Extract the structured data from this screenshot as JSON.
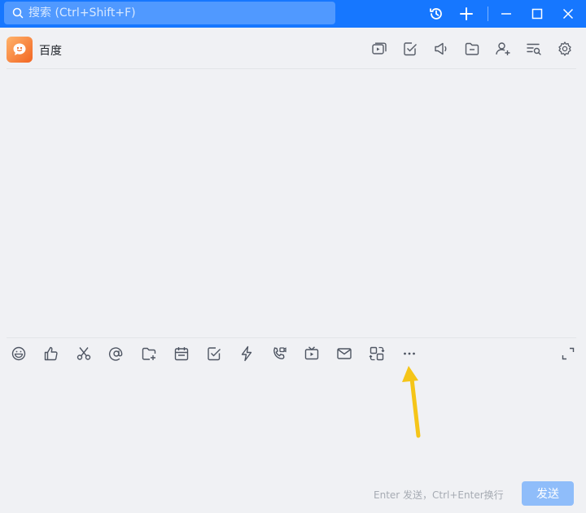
{
  "titlebar": {
    "search_placeholder": "搜索 (Ctrl+Shift+F)",
    "icons": [
      "search-icon",
      "history-icon",
      "plus-icon",
      "minimize-icon",
      "maximize-icon",
      "close-icon"
    ]
  },
  "header": {
    "chat_name": "百度",
    "icons": [
      "video-call-icon",
      "task-check-icon",
      "announcement-icon",
      "folder-icon",
      "add-member-icon",
      "search-history-icon",
      "settings-icon"
    ]
  },
  "toolbar": {
    "icons": [
      "emoji-icon",
      "thumbs-up-icon",
      "scissors-icon",
      "mention-icon",
      "folder-add-icon",
      "calendar-icon",
      "checkbox-icon",
      "lightning-icon",
      "phone-video-icon",
      "live-tv-icon",
      "mail-icon",
      "swap-icon",
      "more-icon",
      "expand-icon"
    ]
  },
  "composer": {
    "hint": "Enter 发送，Ctrl+Enter换行",
    "send_label": "发送"
  },
  "colors": {
    "titlebar": "#1677ff",
    "background": "#f0f1f4",
    "send_button": "#8fbdfa",
    "annotation_arrow": "#f5c518"
  }
}
